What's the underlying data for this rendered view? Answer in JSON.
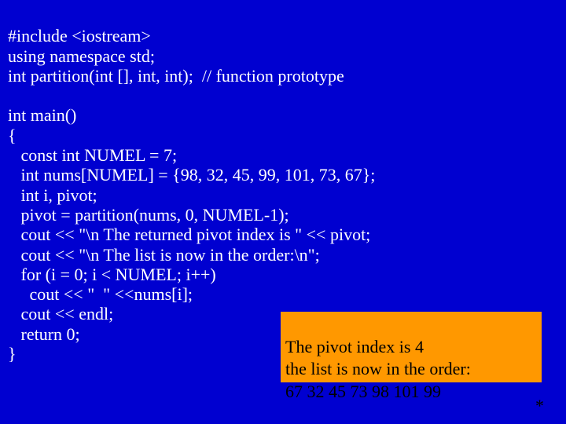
{
  "code": {
    "l1": "#include <iostream>",
    "l2": "using namespace std;",
    "l3": "int partition(int [], int, int);  // function prototype",
    "l4": "",
    "l5": "int main()",
    "l6": "{",
    "l7": "   const int NUMEL = 7;",
    "l8": "   int nums[NUMEL] = {98, 32, 45, 99, 101, 73, 67};",
    "l9": "   int i, pivot;",
    "l10": "   pivot = partition(nums, 0, NUMEL-1);",
    "l11": "   cout << \"\\n The returned pivot index is \" << pivot;",
    "l12": "   cout << \"\\n The list is now in the order:\\n\";",
    "l13": "   for (i = 0; i < NUMEL; i++)",
    "l14": "     cout << \"  \" <<nums[i];",
    "l15": "   cout << endl;",
    "l16": "   return 0;",
    "l17": "}"
  },
  "output": {
    "l1": "The pivot index is 4",
    "l2": "the list is now in the order:",
    "l3": "67 32 45 73 98 101 99"
  },
  "footnote": "*"
}
